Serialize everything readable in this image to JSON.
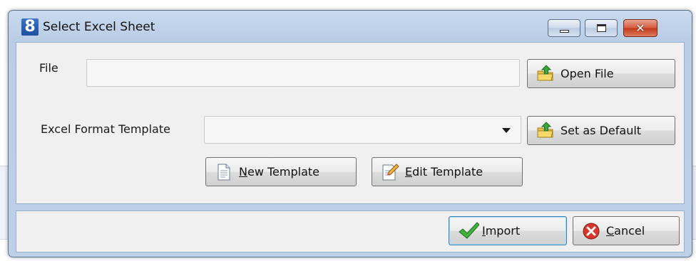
{
  "window": {
    "title": "Select Excel Sheet",
    "app_icon_text": "8"
  },
  "form": {
    "file_label": "File",
    "file_value": "",
    "template_label": "Excel Format Template",
    "template_value": ""
  },
  "buttons": {
    "open_file": "Open File",
    "set_default": "Set as Default",
    "new_template_mnemonic": "N",
    "new_template_rest": "ew Template",
    "edit_template_mnemonic": "E",
    "edit_template_rest": "dit Template",
    "import_mnemonic": "I",
    "import_rest": "mport",
    "cancel_mnemonic": "C",
    "cancel_rest": "ancel"
  },
  "colors": {
    "title_gradient": "#bdd0e8",
    "close_button": "#c23a1c",
    "default_button_border": "#3c7fb1"
  }
}
